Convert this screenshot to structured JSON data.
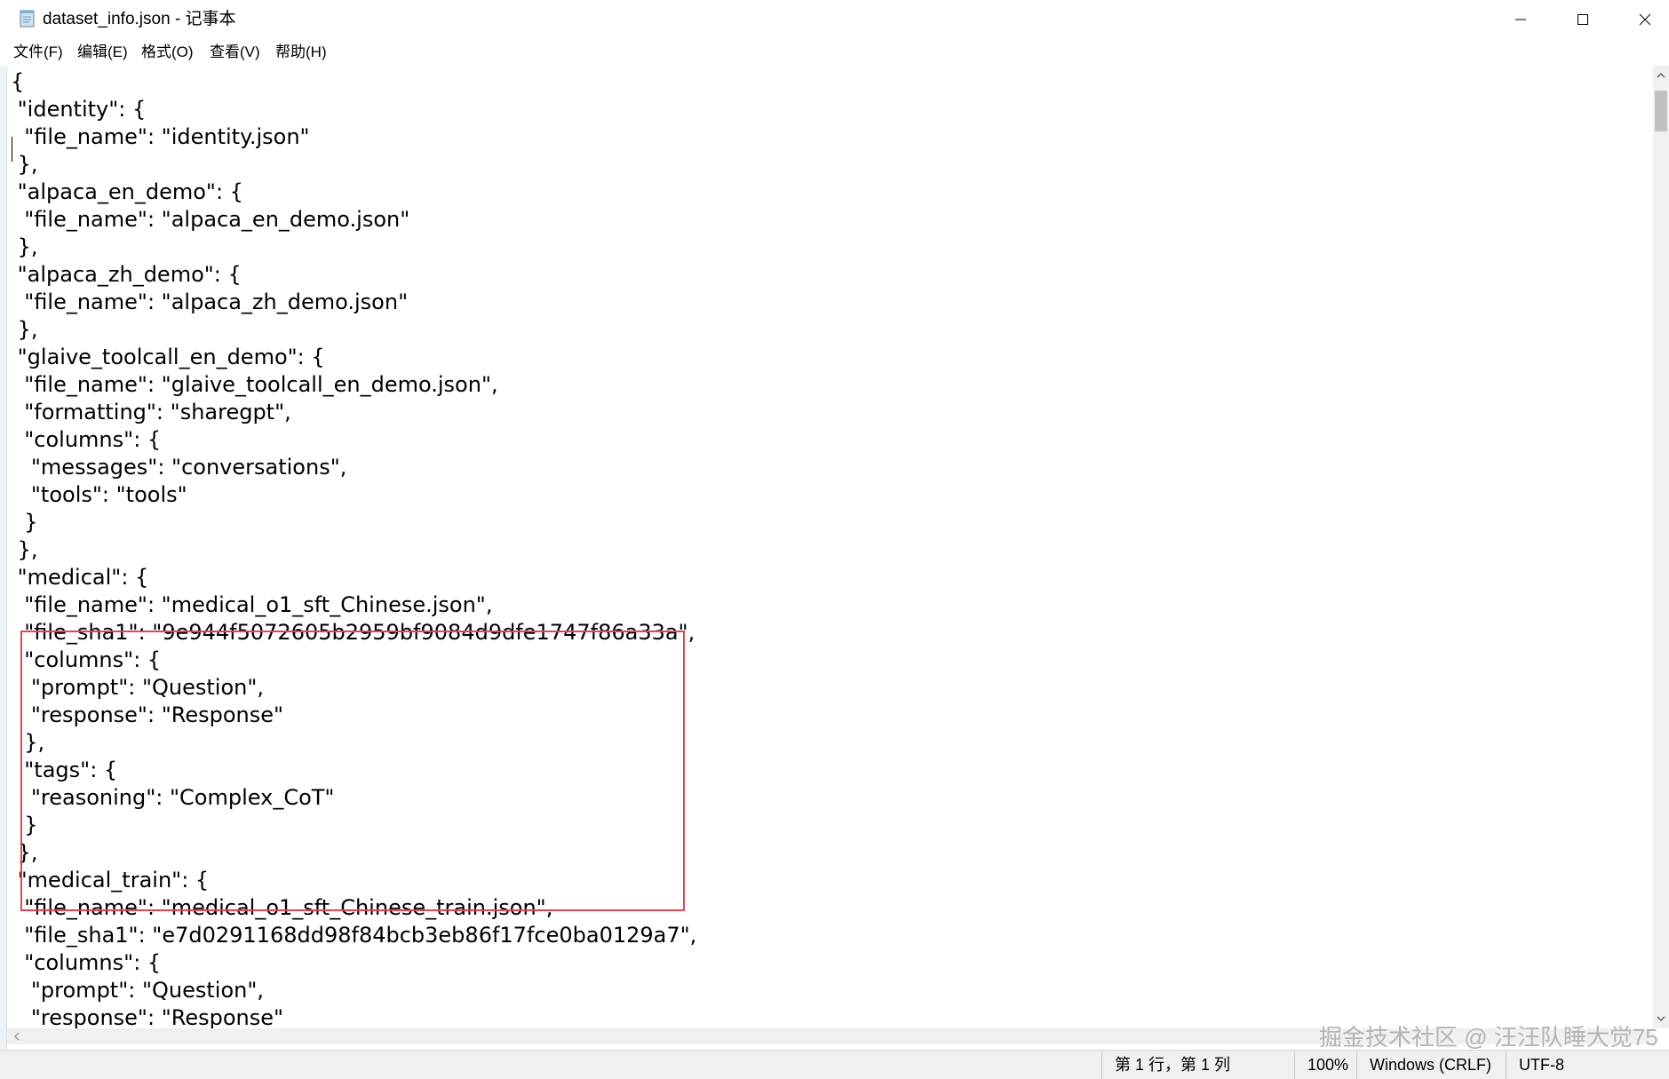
{
  "window": {
    "title": "dataset_info.json - 记事本"
  },
  "menu": {
    "items": [
      "文件(F)",
      "编辑(E)",
      "格式(O)",
      "查看(V)",
      "帮助(H)"
    ]
  },
  "editor": {
    "content": "{\n \"identity\": {\n  \"file_name\": \"identity.json\"\n },\n \"alpaca_en_demo\": {\n  \"file_name\": \"alpaca_en_demo.json\"\n },\n \"alpaca_zh_demo\": {\n  \"file_name\": \"alpaca_zh_demo.json\"\n },\n \"glaive_toolcall_en_demo\": {\n  \"file_name\": \"glaive_toolcall_en_demo.json\",\n  \"formatting\": \"sharegpt\",\n  \"columns\": {\n   \"messages\": \"conversations\",\n   \"tools\": \"tools\"\n  }\n },\n \"medical\": {\n  \"file_name\": \"medical_o1_sft_Chinese.json\",\n  \"file_sha1\": \"9e944f5072605b2959bf9084d9dfe1747f86a33a\",\n  \"columns\": {\n   \"prompt\": \"Question\",\n   \"response\": \"Response\"\n  },\n  \"tags\": {\n   \"reasoning\": \"Complex_CoT\"\n  }\n },\n \"medical_train\": {\n  \"file_name\": \"medical_o1_sft_Chinese_train.json\",\n  \"file_sha1\": \"e7d0291168dd98f84bcb3eb86f17fce0ba0129a7\",\n  \"columns\": {\n   \"prompt\": \"Question\",\n   \"response\": \"Response\""
  },
  "status": {
    "position": "第 1 行，第 1 列",
    "zoom": "100%",
    "line_ending": "Windows (CRLF)",
    "encoding": "UTF-8"
  },
  "watermark": "掘金技术社区 @ 汪汪队睡大觉75",
  "colors": {
    "highlight_border": "#e2454f",
    "scrollbar_thumb": "#c1c1c1",
    "statusbar_bg": "#f0f0f0"
  },
  "icons": {
    "app": "notepad-icon",
    "minimize": "minimize-icon",
    "maximize": "maximize-icon",
    "close": "close-icon",
    "scroll_up": "chevron-up-icon",
    "scroll_down": "chevron-down-icon",
    "scroll_left": "chevron-left-icon"
  }
}
